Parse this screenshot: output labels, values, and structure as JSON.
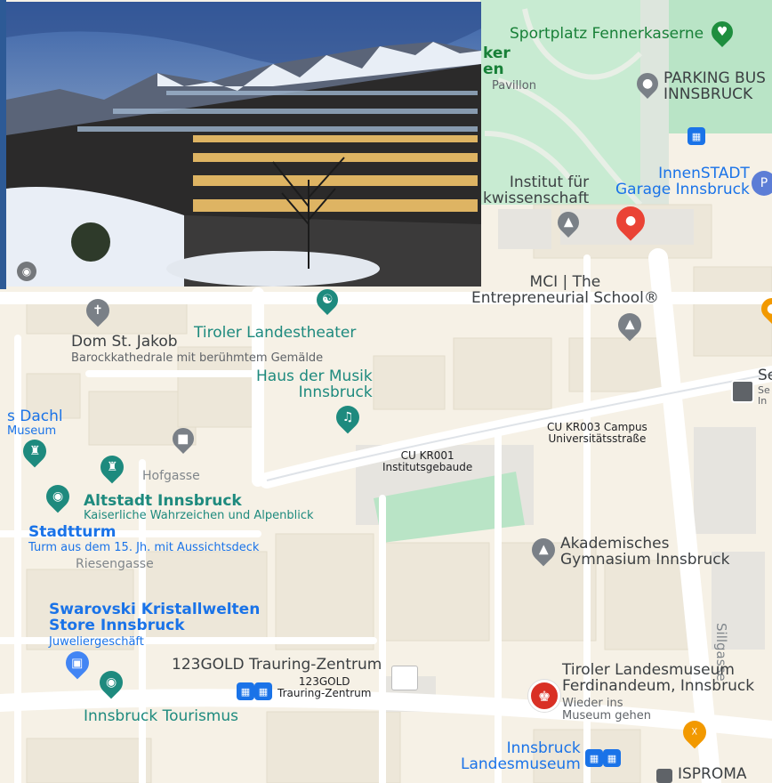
{
  "photo": {
    "camera_icon": "camera-icon"
  },
  "selected_pin": {
    "icon": "red-location-pin-icon",
    "color": "#ea4335"
  },
  "places": {
    "sportplatz": "Sportplatz Fennerkaserne",
    "ker_partial": "ker",
    "en_partial": "en",
    "pavillon": "Pavillon",
    "parking_bus": "PARKING BUS\nINNSBRUCK",
    "innenstadt": "InnenSTADT\nGarage Innsbruck",
    "institut": "Institut für\nkwissenschaft",
    "mci": "MCI | The\nEntrepreneurial School®",
    "dom": "Dom St. Jakob",
    "dom_sub": "Barockkathedrale mit berühmtem Gemälde",
    "landestheater": "Tiroler Landestheater",
    "haus_musik": "Haus der Musik\nInnsbruck",
    "s_dachl": "s Dachl",
    "museum_partial": "Museum",
    "hofgasse": "Hofgasse",
    "altstadt": "Altstadt Innsbruck",
    "altstadt_sub": "Kaiserliche Wahrzeichen und Alpenblick",
    "stadtturm": "Stadtturm",
    "stadtturm_sub": "Turm aus dem 15. Jh. mit Aussichtsdeck",
    "riesengasse": "Riesengasse",
    "swarovski": "Swarovski Kristallwelten\nStore Innsbruck",
    "swarovski_sub": "Juweliergeschäft",
    "cu_kr001": "CU KR001\nInstitutsgebaude",
    "cu_kr003": "CU KR003 Campus\nUniversitätsstraße",
    "akademisches": "Akademisches\nGymnasium Innsbruck",
    "sillgasse": "Sillgasse",
    "trauring": "123GOLD Trauring-Zentrum",
    "trauring_small": "123GOLD\nTrauring-Zentrum",
    "landesmuseum": "Tiroler Landesmuseum\nFerdinandeum, Innsbruck",
    "landesmuseum_sub": "Wieder ins\nMuseum gehen",
    "tourismus": "Innsbruck Tourismus",
    "innsbruck_lm": "Innsbruck\nLandesmuseum",
    "ispromа": "ISPROMA",
    "se_partial": "Se",
    "se_sub": "Se\nIn"
  }
}
